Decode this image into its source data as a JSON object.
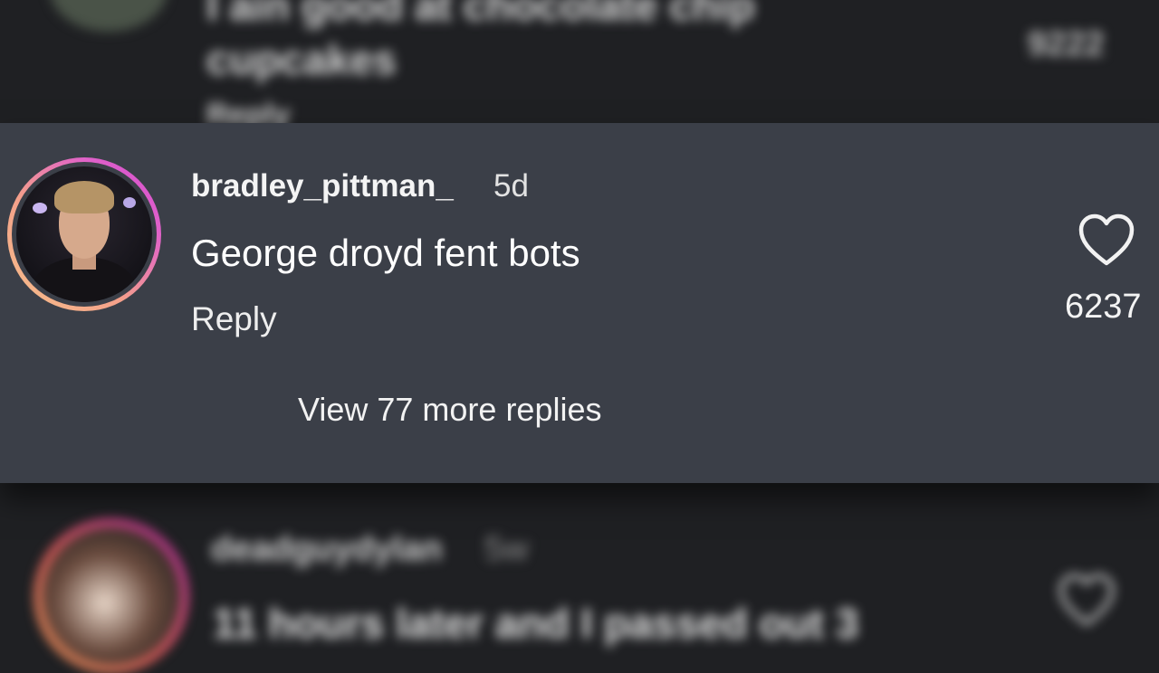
{
  "top_comment": {
    "text": "I ain good at chocolate chip cupcakes",
    "reply_label": "Reply",
    "likes": "9222"
  },
  "main_comment": {
    "username": "bradley_pittman_",
    "time": "5d",
    "text": "George droyd fent bots",
    "reply_label": "Reply",
    "view_replies_label": "View 77 more replies",
    "likes": "6237",
    "like_icon": "heart-outline-icon"
  },
  "bottom_comment": {
    "username": "deadguydylan",
    "time": "5w",
    "text": "11 hours later and I passed out 3",
    "like_icon": "heart-outline-icon"
  },
  "colors": {
    "background": "#1f2023",
    "highlight_panel": "#3b3f48",
    "story_ring_start": "#f6c08a",
    "story_ring_end": "#d24bd1"
  }
}
